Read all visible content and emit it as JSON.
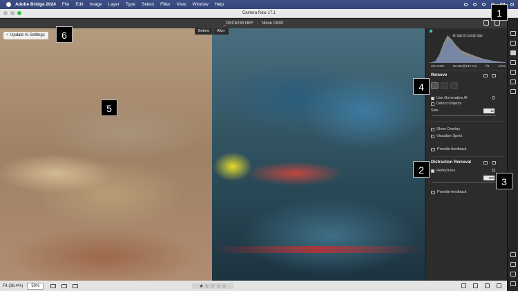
{
  "menubar": {
    "app": "Adobe Bridge 2024",
    "items": [
      "File",
      "Edit",
      "Image",
      "Layer",
      "Type",
      "Select",
      "Filter",
      "View",
      "Window",
      "Help"
    ]
  },
  "window": {
    "title": "Camera Raw 17.1"
  },
  "header": {
    "filename": "_DSC6290.NEF",
    "separator": "-",
    "camera": "Nikon D800"
  },
  "view": {
    "before_label": "Before",
    "after_label": "After",
    "ai_button": "Update AI Settings"
  },
  "histogram": {
    "readout": "R: 161   G: 144   B: 131",
    "iso": "ISO 6400",
    "lens": "28-300@190 mm",
    "aperture": "f/8",
    "shutter": "1/13s"
  },
  "panel": {
    "remove_title": "Remove",
    "use_generative_ai": "Use Generative AI",
    "use_generative_ai_checked": true,
    "detect_objects": "Detect Objects",
    "detect_objects_checked": false,
    "size_label": "Size",
    "size_value": "12",
    "show_overlay": "Show Overlay",
    "visualize_spots": "Visualize Spots",
    "feedback_1": "Provide feedback",
    "distraction_title": "Distraction Removal",
    "reflections_label": "Reflections",
    "reflections_checked": true,
    "reflections_value": "100",
    "feedback_2": "Provide feedback"
  },
  "callouts": [
    "1",
    "2",
    "3",
    "4",
    "5",
    "6"
  ],
  "bottom": {
    "fit": "Fit (36.4%)",
    "zoom": "50%",
    "stars": "★ ☆ ☆ ☆ ☆"
  },
  "colors": {
    "menubar": "#3a4b80",
    "panel": "#2c2c2c",
    "accent_green": "#2ec44a"
  }
}
